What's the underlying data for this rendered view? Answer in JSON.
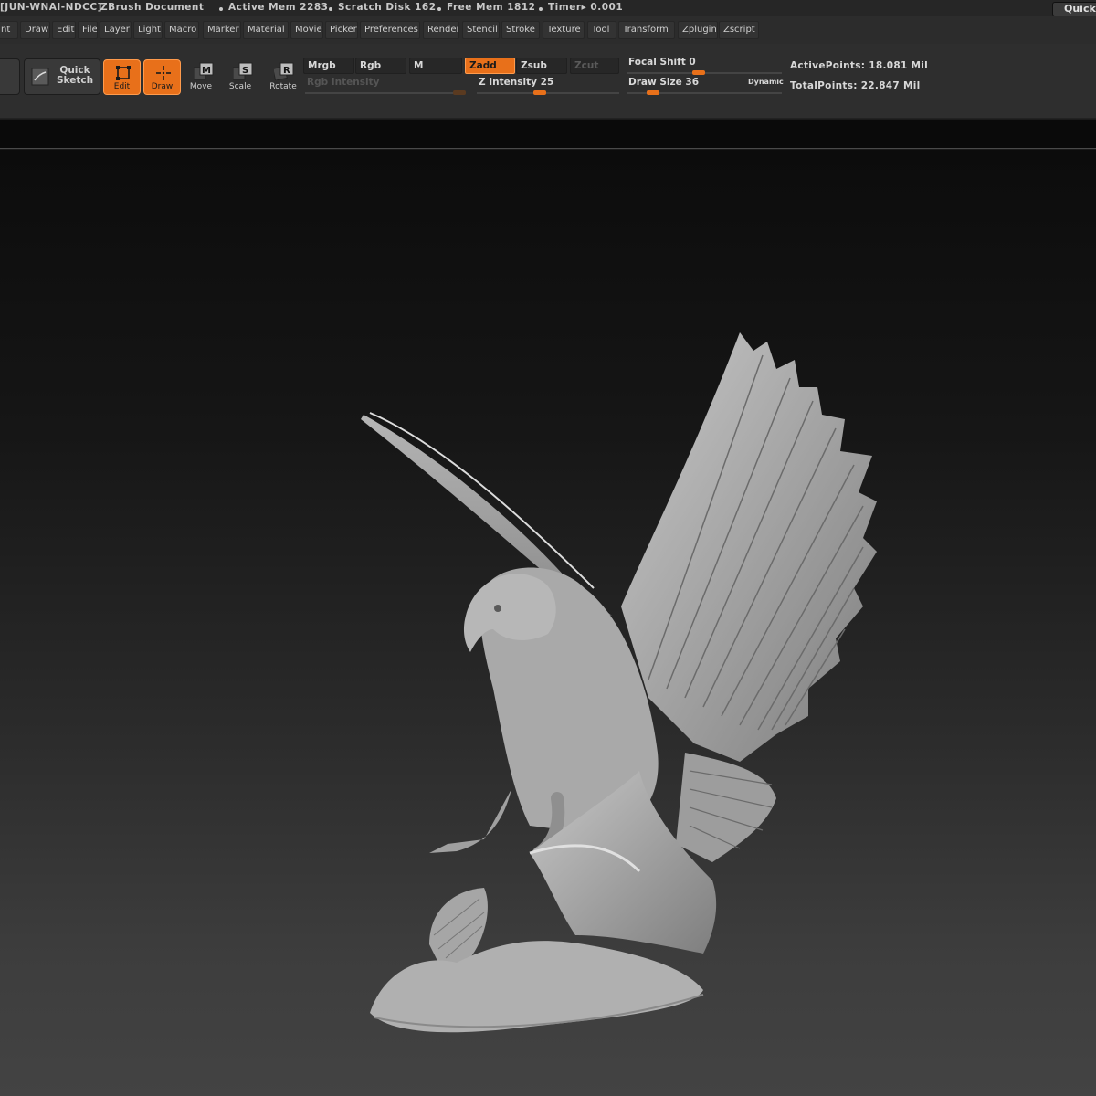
{
  "titlebar": {
    "machine_id": "[JUN-WNAI-NDCC]",
    "document": "ZBrush Document",
    "active_mem": "Active Mem 2283",
    "scratch_disk": "Scratch Disk 162",
    "free_mem": "Free Mem 1812",
    "timer": "Timer▸ 0.001",
    "quicksave": "QuickS"
  },
  "menu": [
    "nt",
    "Draw",
    "Edit",
    "File",
    "Layer",
    "Light",
    "Macro",
    "Marker",
    "Material",
    "Movie",
    "Picker",
    "Preferences",
    "Render",
    "Stencil",
    "Stroke",
    "Texture",
    "Tool",
    "Transform",
    "Zplugin",
    "Zscript"
  ],
  "toolbar": {
    "quick_sketch": "Quick Sketch",
    "edit": "Edit",
    "draw": "Draw",
    "move": "Move",
    "scale": "Scale",
    "rotate": "Rotate",
    "mrgb": "Mrgb",
    "rgb": "Rgb",
    "m": "M",
    "zadd": "Zadd",
    "zsub": "Zsub",
    "zcut": "Zcut",
    "rgb_intensity": "Rgb Intensity",
    "z_intensity": "Z Intensity 25",
    "focal_shift": "Focal Shift 0",
    "draw_size": "Draw Size 36",
    "dynamic": "Dynamic",
    "active_points": "ActivePoints: 18.081  Mil",
    "total_points": "TotalPoints: 22.847  Mil"
  },
  "sliders": {
    "rgb_intensity": 0.97,
    "z_intensity": 0.25,
    "focal_shift": 0.5,
    "draw_size": 0.2
  },
  "colors": {
    "accent": "#e8701a",
    "panel": "#2e2e2e",
    "canvas_bottom": "#434343"
  },
  "icons": [
    "quick-sketch-icon",
    "edit-icon",
    "draw-icon",
    "move-icon",
    "scale-icon",
    "rotate-icon"
  ]
}
